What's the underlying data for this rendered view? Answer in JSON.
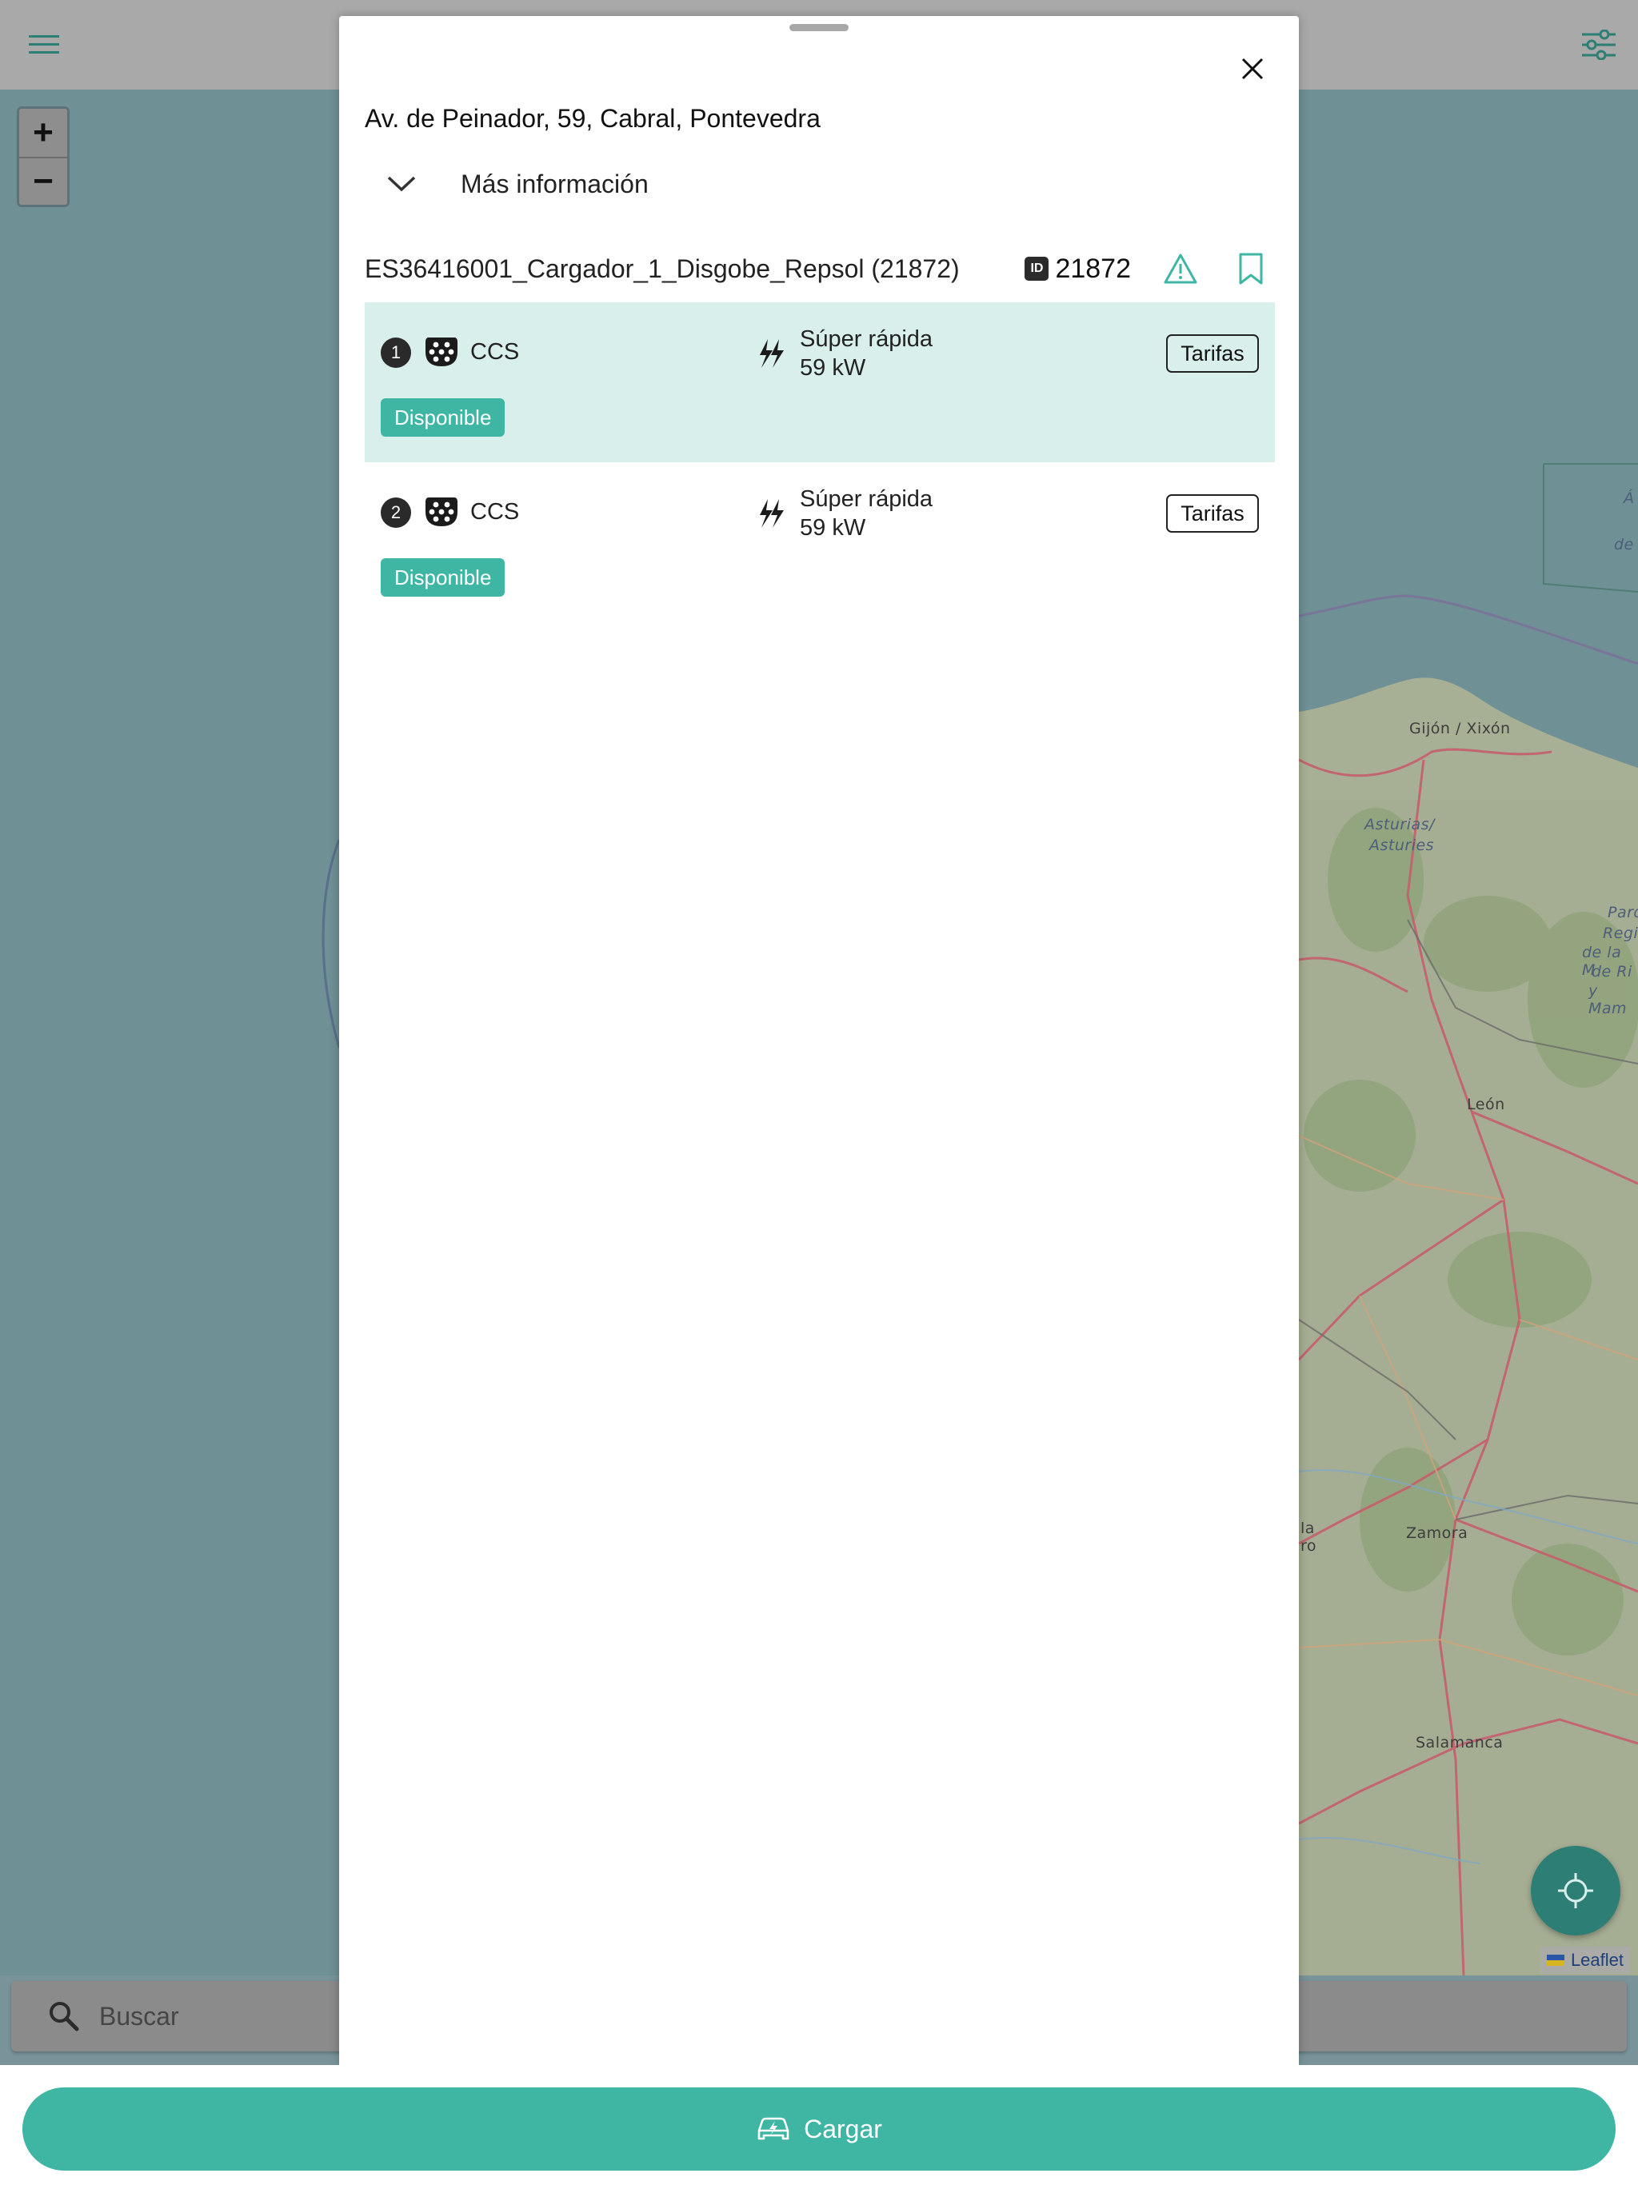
{
  "map": {
    "labels": [
      {
        "text": "Gijón / Xixón",
        "italic": false
      },
      {
        "text": "Asturias/",
        "italic": true
      },
      {
        "text": "Asturies",
        "italic": true
      },
      {
        "text": "León",
        "italic": false
      },
      {
        "text": "Zamora",
        "italic": false
      },
      {
        "text": "Salamanca",
        "italic": false
      },
      {
        "text": "Parq",
        "italic": true
      },
      {
        "text": "Regi",
        "italic": true
      },
      {
        "text": "de la M",
        "italic": true
      },
      {
        "text": "de Ri",
        "italic": true
      },
      {
        "text": "y Mam",
        "italic": true
      },
      {
        "text": "Á",
        "italic": true
      },
      {
        "text": "de",
        "italic": true
      },
      {
        "text": "la",
        "italic": false
      },
      {
        "text": "ro",
        "italic": false
      }
    ],
    "attribution": "Leaflet"
  },
  "topbar": {
    "menu_icon": "hamburger-menu-icon",
    "filter_icon": "sliders-filter-icon"
  },
  "zoom": {
    "in_label": "+",
    "out_label": "−"
  },
  "search": {
    "placeholder": "Buscar",
    "value": ""
  },
  "panel": {
    "address": "Av. de Peinador, 59, Cabral, Pontevedra",
    "more_info_label": "Más información",
    "station_name": "ES36416001_Cargador_1_Disgobe_Repsol (21872)",
    "id_badge": "ID",
    "station_id": "21872",
    "connectors": [
      {
        "number": "1",
        "type": "CCS",
        "speed": "Súper rápida",
        "power": "59 kW",
        "tarifas": "Tarifas",
        "status": "Disponible",
        "selected": true
      },
      {
        "number": "2",
        "type": "CCS",
        "speed": "Súper rápida",
        "power": "59 kW",
        "tarifas": "Tarifas",
        "status": "Disponible",
        "selected": false
      }
    ]
  },
  "cta": {
    "label": "Cargar"
  },
  "colors": {
    "accent": "#3fb5a4",
    "selected_row": "#d8efec",
    "topbar": "#a9a9a9",
    "map_overlay": "#6f9095"
  }
}
